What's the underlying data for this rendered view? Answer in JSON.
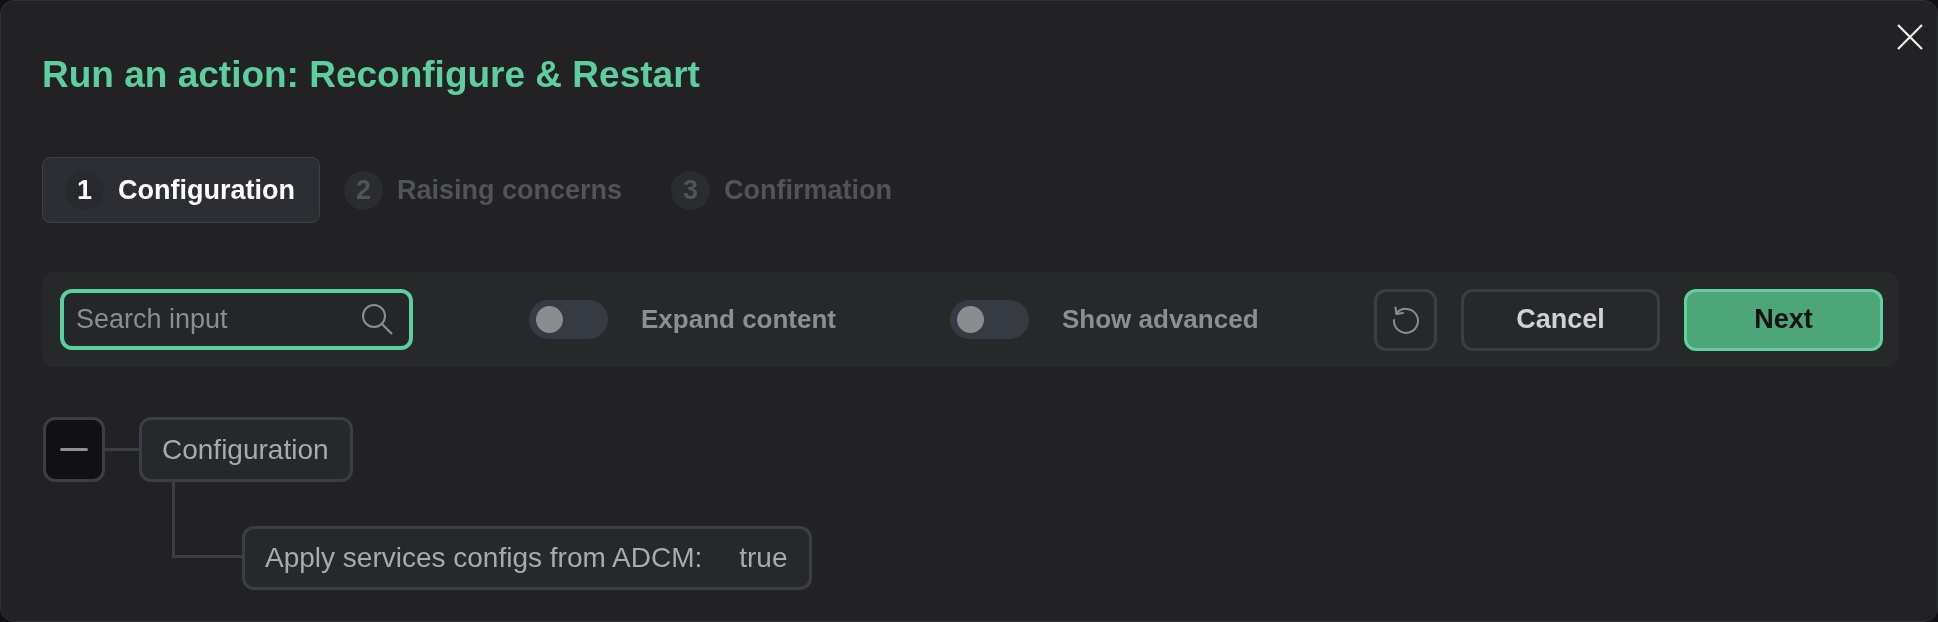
{
  "dialog": {
    "title": "Run an action: Reconfigure & Restart"
  },
  "steps": [
    {
      "number": "1",
      "label": "Configuration",
      "selected": true
    },
    {
      "number": "2",
      "label": "Raising concerns",
      "selected": false
    },
    {
      "number": "3",
      "label": "Confirmation",
      "selected": false
    }
  ],
  "toolbar": {
    "search": {
      "placeholder": "Search input",
      "focused": true
    },
    "toggles": [
      {
        "label": "Expand content",
        "on": false
      },
      {
        "label": "Show advanced",
        "on": false
      }
    ],
    "buttons": [
      {
        "kind": "icon"
      },
      {
        "kind": "outline",
        "label": "Cancel"
      },
      {
        "kind": "filled",
        "label": "Next"
      }
    ]
  },
  "tree": [
    {
      "label": "Configuration",
      "expanded": true,
      "children": [
        {
          "label": "Apply services configs from ADCM:",
          "value": "true"
        }
      ]
    }
  ]
}
